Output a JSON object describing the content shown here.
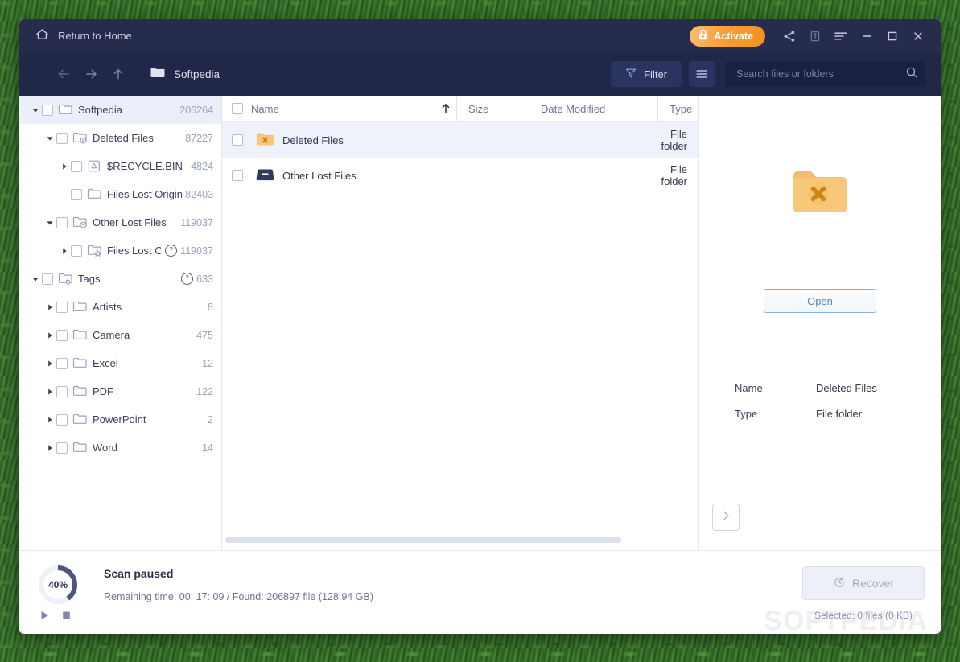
{
  "titlebar": {
    "home_label": "Return to Home",
    "activate_label": "Activate",
    "icons": [
      "share-icon",
      "export-icon",
      "menu-icon",
      "minimize-icon",
      "maximize-icon",
      "close-icon"
    ]
  },
  "toolbar": {
    "breadcrumb": "Softpedia",
    "filter_label": "Filter",
    "search_placeholder": "Search files or folders",
    "search_value": ""
  },
  "sidebar": {
    "items": [
      {
        "label": "Softpedia",
        "count": "206264",
        "indent": 0,
        "caret": "down",
        "icon": "folder-icon",
        "selected": true,
        "help": false
      },
      {
        "label": "Deleted Files",
        "count": "87227",
        "indent": 1,
        "caret": "down",
        "icon": "folder-deleted-icon",
        "selected": false,
        "help": false
      },
      {
        "label": "$RECYCLE.BIN",
        "count": "4824",
        "indent": 2,
        "caret": "right",
        "icon": "recycle-icon",
        "selected": false,
        "help": false
      },
      {
        "label": "Files Lost Original Di…",
        "count": "82403",
        "indent": 2,
        "caret": "none",
        "icon": "folder-icon",
        "selected": false,
        "help": false
      },
      {
        "label": "Other Lost Files",
        "count": "119037",
        "indent": 1,
        "caret": "down",
        "icon": "folder-lost-icon",
        "selected": false,
        "help": false
      },
      {
        "label": "Files Lost Origi…",
        "count": "119037",
        "indent": 2,
        "caret": "right",
        "icon": "folder-star-icon",
        "selected": false,
        "help": true
      },
      {
        "label": "Tags",
        "count": "633",
        "indent": 0,
        "caret": "down",
        "icon": "folder-tag-icon",
        "selected": false,
        "help": true
      },
      {
        "label": "Artists",
        "count": "8",
        "indent": 1,
        "caret": "right",
        "icon": "folder-icon",
        "selected": false,
        "help": false
      },
      {
        "label": "Camera",
        "count": "475",
        "indent": 1,
        "caret": "right",
        "icon": "folder-icon",
        "selected": false,
        "help": false
      },
      {
        "label": "Excel",
        "count": "12",
        "indent": 1,
        "caret": "right",
        "icon": "folder-icon",
        "selected": false,
        "help": false
      },
      {
        "label": "PDF",
        "count": "122",
        "indent": 1,
        "caret": "right",
        "icon": "folder-icon",
        "selected": false,
        "help": false
      },
      {
        "label": "PowerPoint",
        "count": "2",
        "indent": 1,
        "caret": "right",
        "icon": "folder-icon",
        "selected": false,
        "help": false
      },
      {
        "label": "Word",
        "count": "14",
        "indent": 1,
        "caret": "right",
        "icon": "folder-icon",
        "selected": false,
        "help": false
      }
    ]
  },
  "filelist": {
    "columns": [
      "Name",
      "Size",
      "Date Modified",
      "Type"
    ],
    "sort_direction": "asc",
    "rows": [
      {
        "name": "Deleted Files",
        "size": "",
        "date": "",
        "type": "File folder",
        "icon": "folder-deleted-orange-icon",
        "selected": true
      },
      {
        "name": "Other Lost Files",
        "size": "",
        "date": "",
        "type": "File folder",
        "icon": "drive-icon",
        "selected": false
      }
    ]
  },
  "preview": {
    "icon": "folder-deleted-orange-icon",
    "open_label": "Open",
    "properties": [
      {
        "key": "Name",
        "value": "Deleted Files"
      },
      {
        "key": "Type",
        "value": "File folder"
      }
    ],
    "expand_icon": "chevron-right-icon"
  },
  "status": {
    "progress_percent": "40%",
    "progress_value": 40,
    "title": "Scan paused",
    "detail": "Remaining time: 00: 17: 09 / Found: 206897 file (128.94 GB)",
    "resume_icon": "play-icon",
    "stop_icon": "stop-icon",
    "recover_label": "Recover",
    "selected_text": "Selected: 0 files (0 KB)",
    "watermark": "SOFTPEDIA"
  },
  "colors": {
    "titlebar": "#252c4e",
    "toolbar": "#202748",
    "accent_orange": "#f3901f",
    "accent_blue": "#3f8ad8",
    "selection": "#eff1fb"
  }
}
